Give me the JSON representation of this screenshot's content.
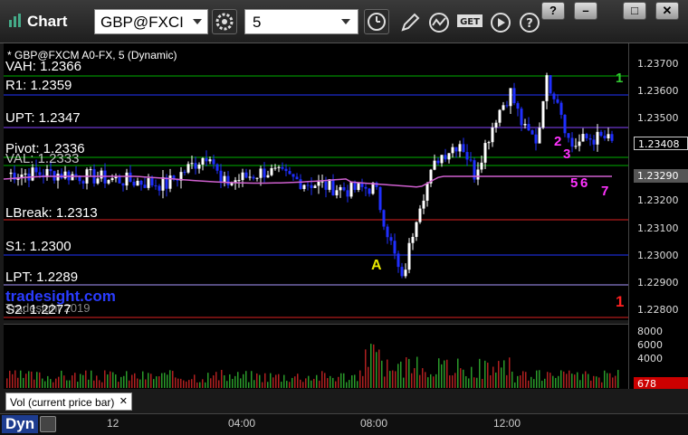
{
  "titlebar": {
    "app_title": "Chart",
    "symbol": "GBP@FXCI",
    "period": "5",
    "window_buttons": [
      "?",
      "–",
      "□",
      "✕"
    ]
  },
  "chart": {
    "legend": "* GBP@FXCM A0-FX, 5 (Dynamic)",
    "levels": [
      {
        "name": "vah",
        "label": "VAH: 1.2366",
        "color": "#00b000"
      },
      {
        "name": "r1",
        "label": "R1: 1.2359",
        "color": "#2233ff"
      },
      {
        "name": "upt",
        "label": "UPT: 1.2347",
        "color": "#8844ff"
      },
      {
        "name": "pivot",
        "label": "Pivot: 1.2336",
        "color": "#00b000"
      },
      {
        "name": "val",
        "label": "VAL: 1.2333",
        "color": "#00b000"
      },
      {
        "name": "lbreak",
        "label": "LBreak: 1.2313",
        "color": "#dd2222"
      },
      {
        "name": "s1",
        "label": "S1: 1.2300",
        "color": "#2233ff"
      },
      {
        "name": "lpt",
        "label": "LPT: 1.2289",
        "color": "#aa99ff"
      },
      {
        "name": "s2",
        "label": "S2: 1.2277",
        "color": "#dd2222"
      }
    ],
    "watermark": "tradesight.com",
    "copyright": "Tradesight 2019",
    "markers": {
      "a": "A",
      "red_1": "1",
      "green_1": "1",
      "m2": "2",
      "m3": "3",
      "m5": "5",
      "m6": "6",
      "m7": "7"
    },
    "yaxis_ticks": [
      "1.23700",
      "1.23600",
      "1.23500",
      "1.23408",
      "1.23290",
      "1.23200",
      "1.23100",
      "1.23000",
      "1.22900",
      "1.22800"
    ],
    "last_price": "1.23408",
    "vwap_price": "1.23290",
    "colors": {
      "bull": "#ffffff",
      "bear": "#1f2fff",
      "vwap": "#d060d0",
      "value_area": "#777777",
      "last_price_tag": "#000000",
      "vwap_tag": "#555555"
    }
  },
  "volume": {
    "label": "Vol (current price bar)",
    "ticks": [
      "8000",
      "6000",
      "4000"
    ],
    "current": "678",
    "current_color": "#cc0000"
  },
  "timebar": {
    "dyn": "Dyn",
    "labels": [
      "12",
      "04:00",
      "08:00",
      "12:00"
    ]
  }
}
